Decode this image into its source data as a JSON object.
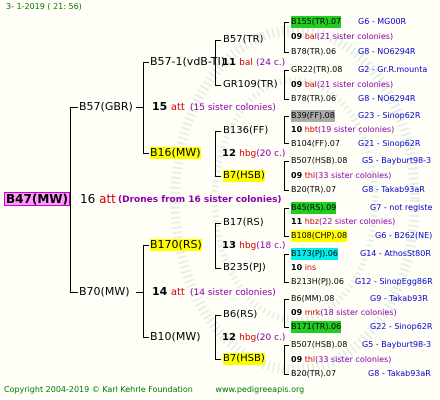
{
  "header": {
    "date": "3-  1-2019 ( 21:  56)"
  },
  "root": {
    "label": "B47(MW)",
    "generation_num": "16",
    "generation_word": "att",
    "note": "(Drones from 16 sister colonies)"
  },
  "gen1": [
    {
      "label": "B57(GBR)",
      "num": "15",
      "word": "att",
      "note": "(15 sister colonies)"
    },
    {
      "label": "B70(MW)",
      "num": "14",
      "word": "att",
      "note": "(14 sister colonies)"
    }
  ],
  "gen2": [
    {
      "label": "B57-1(vdB-TI)",
      "num": "11",
      "word": "bal",
      "note": "(24 c.)"
    },
    {
      "label": "B16(MW)",
      "num": "12",
      "word": "hbg",
      "note": "(20 c.)"
    },
    {
      "label": "B170(RS)",
      "num": "13",
      "word": "hbg",
      "note": "(18 c.)"
    },
    {
      "label": "B10(MW)",
      "num": "12",
      "word": "hbg",
      "note": "(20 c.)"
    }
  ],
  "gen3": [
    {
      "label": "B57(TR)"
    },
    {
      "label": "GR109(TR)"
    },
    {
      "label": "B136(FF)"
    },
    {
      "label": "B7(HSB)"
    },
    {
      "label": "B17(RS)"
    },
    {
      "label": "B235(PJ)"
    },
    {
      "label": "B6(RS)"
    },
    {
      "label": "B7(HSB)"
    }
  ],
  "gen4": [
    {
      "top": "B155(TR).07",
      "top_note": "G6 - MG00R",
      "mid": "09",
      "word": "bal",
      "mid_note": "(21 sister colonies)",
      "bottom": "B78(TR).06",
      "bottom_note": "G8 - NO6294R"
    },
    {
      "top": "GR22(TR).08",
      "top_note": "G2 - Gr.R.mounta",
      "mid": "09",
      "word": "bal",
      "mid_note": "(21 sister colonies)",
      "bottom": "B78(TR).06",
      "bottom_note": "G8 - NO6294R"
    },
    {
      "top": "B39(FF).08",
      "top_note": "G23 - Sinop62R",
      "mid": "10",
      "word": "hbt",
      "mid_note": "(19 sister colonies)",
      "bottom": "B104(FF).07",
      "bottom_note": "G21 - Sinop62R"
    },
    {
      "top": "B507(HSB).08",
      "top_note": "G5 - Bayburt98-3",
      "mid": "09",
      "word": "thl",
      "mid_note": "(33 sister colonies)",
      "bottom": "B20(TR).07",
      "bottom_note": "G8 - Takab93aR"
    },
    {
      "top": "B45(RS).09",
      "top_note": "G7 - not registe",
      "mid": "11",
      "word": "hbz",
      "mid_note": "(22 sister colonies)",
      "bottom": "B108(CHP).08",
      "bottom_note": "G6 - B262(NE)"
    },
    {
      "top": "B173(PJ).06",
      "top_note": "G14 - AthosSt80R",
      "mid": "10",
      "word": "ins",
      "mid_note": "",
      "bottom": "B213H(PJ).06",
      "bottom_note": "G12 - SinopEgg86R"
    },
    {
      "top": "B6(MM).08",
      "top_note": "G9 - Takab93R",
      "mid": "09",
      "word": "mrk",
      "mid_note": "(18 sister colonies)",
      "bottom": "B171(TR).06",
      "bottom_note": "G22 - Sinop62R"
    },
    {
      "top": "B507(HSB).08",
      "top_note": "G5 - Bayburt98-3",
      "mid": "09",
      "word": "thl",
      "mid_note": "(33 sister colonies)",
      "bottom": "B20(TR).07",
      "bottom_note": "G8 - Takab93aR"
    }
  ],
  "footer": {
    "copyright": "Copyright 2004-2019 © Karl Kehrle Foundation",
    "url": "www.pedigreeapis.org"
  }
}
